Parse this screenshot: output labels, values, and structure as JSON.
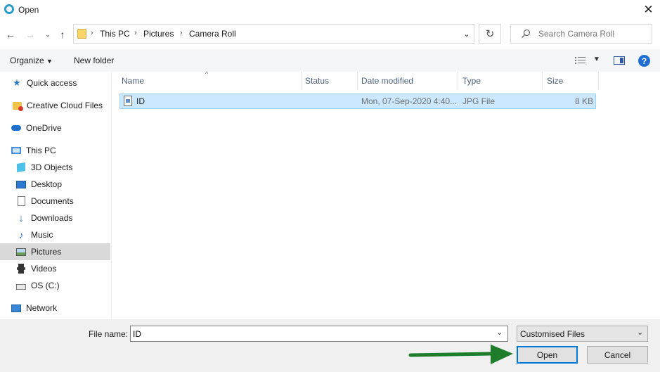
{
  "window": {
    "title": "Open"
  },
  "address": {
    "crumbs": [
      "This PC",
      "Pictures",
      "Camera Roll"
    ],
    "search_placeholder": "Search Camera Roll"
  },
  "toolbar": {
    "organize": "Organize",
    "new_folder": "New folder"
  },
  "nav": {
    "items": [
      {
        "label": "Quick access",
        "icon": "star-icon"
      },
      {
        "label": "Creative Cloud Files",
        "icon": "creative-cloud-folder-icon"
      },
      {
        "label": "OneDrive",
        "icon": "cloud-icon"
      },
      {
        "label": "This PC",
        "icon": "computer-icon"
      },
      {
        "label": "3D Objects",
        "icon": "cube-icon"
      },
      {
        "label": "Desktop",
        "icon": "desktop-icon"
      },
      {
        "label": "Documents",
        "icon": "document-icon"
      },
      {
        "label": "Downloads",
        "icon": "download-icon"
      },
      {
        "label": "Music",
        "icon": "music-icon"
      },
      {
        "label": "Pictures",
        "icon": "pictures-icon",
        "selected": true
      },
      {
        "label": "Videos",
        "icon": "video-icon"
      },
      {
        "label": "OS (C:)",
        "icon": "drive-icon"
      },
      {
        "label": "Network",
        "icon": "network-icon"
      }
    ]
  },
  "columns": {
    "name": "Name",
    "status": "Status",
    "date": "Date modified",
    "type": "Type",
    "size": "Size"
  },
  "files": [
    {
      "name": "ID",
      "status": "",
      "date": "Mon, 07-Sep-2020 4:40...",
      "type": "JPG File",
      "size": "8 KB"
    }
  ],
  "footer": {
    "file_name_label": "File name:",
    "file_name_value": "ID",
    "file_type": "Customised Files",
    "open": "Open",
    "cancel": "Cancel"
  },
  "colors": {
    "accent": "#0078d7",
    "selection": "#cce8ff",
    "arrow": "#1e7d2b"
  }
}
